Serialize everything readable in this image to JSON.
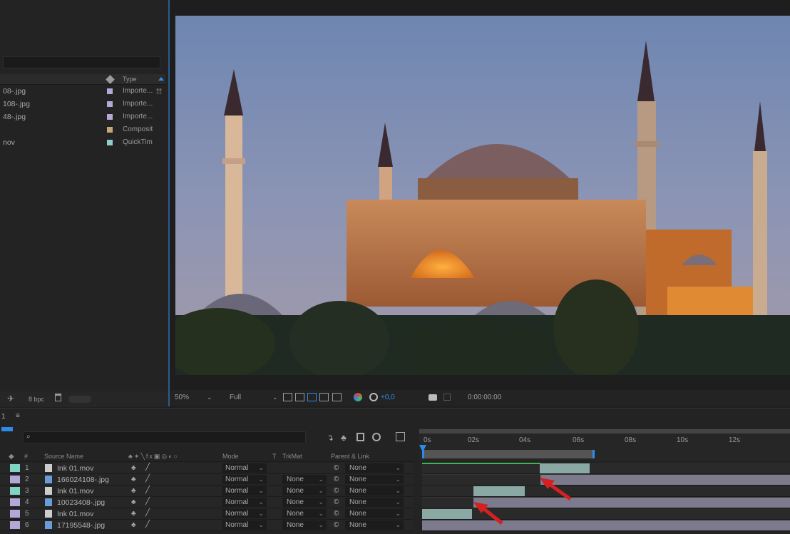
{
  "project": {
    "col_type": "Type",
    "items": [
      {
        "name": "08-.jpg",
        "type": "Importe...",
        "color": "#b4a8d8"
      },
      {
        "name": "108-.jpg",
        "type": "Importe...",
        "color": "#b4a8d8"
      },
      {
        "name": "48-.jpg",
        "type": "Importe...",
        "color": "#b4a8d8"
      },
      {
        "name": "",
        "type": "Composit",
        "color": "#c2a878"
      },
      {
        "name": "nov",
        "type": "QuickTim",
        "color": "#8ccfc4"
      }
    ],
    "bpc": "8 bpc"
  },
  "viewer": {
    "zoom": "50%",
    "resolution": "Full",
    "exposure": "+0,0",
    "timecode": "0:00:00:00"
  },
  "timeline": {
    "tab": "1",
    "headers": {
      "source_name": "Source Name",
      "mode": "Mode",
      "t": "T",
      "trkmat": "TrkMat",
      "parent": "Parent & Link"
    },
    "ruler": [
      "0s",
      "02s",
      "04s",
      "06s",
      "08s",
      "10s",
      "12s"
    ],
    "layers": [
      {
        "num": "1",
        "name": "Ink 01.mov",
        "mode": "Normal",
        "trkmat": "",
        "parent": "None",
        "color": "#7fd4c4",
        "kind": "movie"
      },
      {
        "num": "2",
        "name": "166024108-.jpg",
        "mode": "Normal",
        "trkmat": "None",
        "parent": "None",
        "color": "#b4a8d8",
        "kind": "image"
      },
      {
        "num": "3",
        "name": "Ink 01.mov",
        "mode": "Normal",
        "trkmat": "None",
        "parent": "None",
        "color": "#7fd4c4",
        "kind": "movie"
      },
      {
        "num": "4",
        "name": "10023408-.jpg",
        "mode": "Normal",
        "trkmat": "None",
        "parent": "None",
        "color": "#b4a8d8",
        "kind": "image"
      },
      {
        "num": "5",
        "name": "Ink 01.mov",
        "mode": "Normal",
        "trkmat": "None",
        "parent": "None",
        "color": "#7fd4c4",
        "kind": "movie"
      },
      {
        "num": "6",
        "name": "17195548-.jpg",
        "mode": "Normal",
        "trkmat": "None",
        "parent": "None",
        "color": "#b4a8d8",
        "kind": "image"
      }
    ]
  }
}
